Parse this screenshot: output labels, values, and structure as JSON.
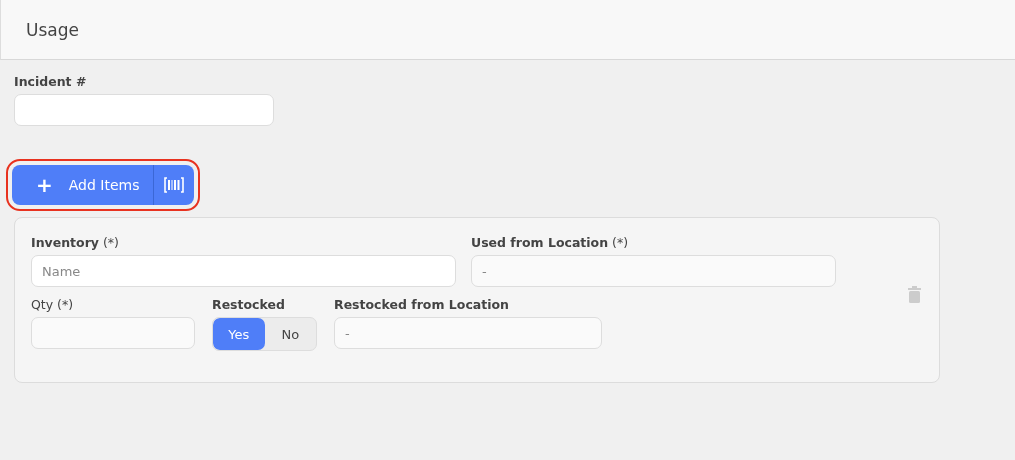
{
  "header": {
    "title": "Usage"
  },
  "incident": {
    "label": "Incident #"
  },
  "add_items": {
    "label": "Add Items",
    "icon": "+",
    "highlighted": true
  },
  "item": {
    "inventory": {
      "label": "**Inventory** (*)",
      "placeholder": "Name"
    },
    "used_from": {
      "label": "**Used from Location** (*)",
      "placeholder": "-"
    },
    "qty": {
      "label": "Qty (*)"
    },
    "restocked": {
      "label": "Restocked",
      "options": [
        {
          "label": "Yes",
          "selected": true
        },
        {
          "label": "No",
          "selected": false
        }
      ]
    },
    "restocked_from": {
      "label": "Restocked from Location",
      "placeholder": "-"
    }
  }
}
